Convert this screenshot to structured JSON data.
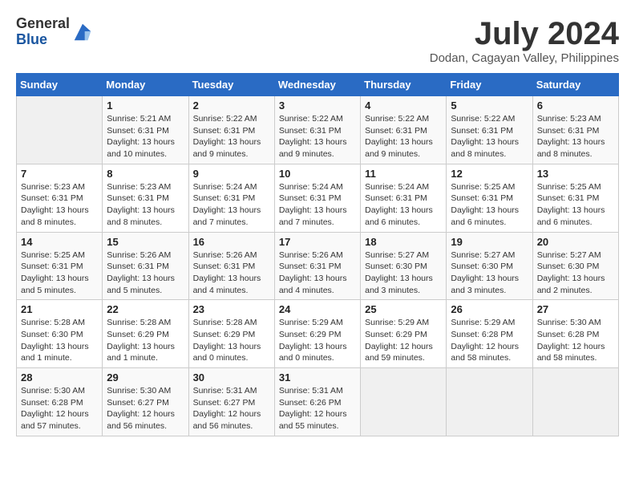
{
  "header": {
    "logo_line1": "General",
    "logo_line2": "Blue",
    "month_title": "July 2024",
    "location": "Dodan, Cagayan Valley, Philippines"
  },
  "weekdays": [
    "Sunday",
    "Monday",
    "Tuesday",
    "Wednesday",
    "Thursday",
    "Friday",
    "Saturday"
  ],
  "weeks": [
    [
      {
        "day": "",
        "info": ""
      },
      {
        "day": "1",
        "info": "Sunrise: 5:21 AM\nSunset: 6:31 PM\nDaylight: 13 hours\nand 10 minutes."
      },
      {
        "day": "2",
        "info": "Sunrise: 5:22 AM\nSunset: 6:31 PM\nDaylight: 13 hours\nand 9 minutes."
      },
      {
        "day": "3",
        "info": "Sunrise: 5:22 AM\nSunset: 6:31 PM\nDaylight: 13 hours\nand 9 minutes."
      },
      {
        "day": "4",
        "info": "Sunrise: 5:22 AM\nSunset: 6:31 PM\nDaylight: 13 hours\nand 9 minutes."
      },
      {
        "day": "5",
        "info": "Sunrise: 5:22 AM\nSunset: 6:31 PM\nDaylight: 13 hours\nand 8 minutes."
      },
      {
        "day": "6",
        "info": "Sunrise: 5:23 AM\nSunset: 6:31 PM\nDaylight: 13 hours\nand 8 minutes."
      }
    ],
    [
      {
        "day": "7",
        "info": "Sunrise: 5:23 AM\nSunset: 6:31 PM\nDaylight: 13 hours\nand 8 minutes."
      },
      {
        "day": "8",
        "info": "Sunrise: 5:23 AM\nSunset: 6:31 PM\nDaylight: 13 hours\nand 8 minutes."
      },
      {
        "day": "9",
        "info": "Sunrise: 5:24 AM\nSunset: 6:31 PM\nDaylight: 13 hours\nand 7 minutes."
      },
      {
        "day": "10",
        "info": "Sunrise: 5:24 AM\nSunset: 6:31 PM\nDaylight: 13 hours\nand 7 minutes."
      },
      {
        "day": "11",
        "info": "Sunrise: 5:24 AM\nSunset: 6:31 PM\nDaylight: 13 hours\nand 6 minutes."
      },
      {
        "day": "12",
        "info": "Sunrise: 5:25 AM\nSunset: 6:31 PM\nDaylight: 13 hours\nand 6 minutes."
      },
      {
        "day": "13",
        "info": "Sunrise: 5:25 AM\nSunset: 6:31 PM\nDaylight: 13 hours\nand 6 minutes."
      }
    ],
    [
      {
        "day": "14",
        "info": "Sunrise: 5:25 AM\nSunset: 6:31 PM\nDaylight: 13 hours\nand 5 minutes."
      },
      {
        "day": "15",
        "info": "Sunrise: 5:26 AM\nSunset: 6:31 PM\nDaylight: 13 hours\nand 5 minutes."
      },
      {
        "day": "16",
        "info": "Sunrise: 5:26 AM\nSunset: 6:31 PM\nDaylight: 13 hours\nand 4 minutes."
      },
      {
        "day": "17",
        "info": "Sunrise: 5:26 AM\nSunset: 6:31 PM\nDaylight: 13 hours\nand 4 minutes."
      },
      {
        "day": "18",
        "info": "Sunrise: 5:27 AM\nSunset: 6:30 PM\nDaylight: 13 hours\nand 3 minutes."
      },
      {
        "day": "19",
        "info": "Sunrise: 5:27 AM\nSunset: 6:30 PM\nDaylight: 13 hours\nand 3 minutes."
      },
      {
        "day": "20",
        "info": "Sunrise: 5:27 AM\nSunset: 6:30 PM\nDaylight: 13 hours\nand 2 minutes."
      }
    ],
    [
      {
        "day": "21",
        "info": "Sunrise: 5:28 AM\nSunset: 6:30 PM\nDaylight: 13 hours\nand 1 minute."
      },
      {
        "day": "22",
        "info": "Sunrise: 5:28 AM\nSunset: 6:29 PM\nDaylight: 13 hours\nand 1 minute."
      },
      {
        "day": "23",
        "info": "Sunrise: 5:28 AM\nSunset: 6:29 PM\nDaylight: 13 hours\nand 0 minutes."
      },
      {
        "day": "24",
        "info": "Sunrise: 5:29 AM\nSunset: 6:29 PM\nDaylight: 13 hours\nand 0 minutes."
      },
      {
        "day": "25",
        "info": "Sunrise: 5:29 AM\nSunset: 6:29 PM\nDaylight: 12 hours\nand 59 minutes."
      },
      {
        "day": "26",
        "info": "Sunrise: 5:29 AM\nSunset: 6:28 PM\nDaylight: 12 hours\nand 58 minutes."
      },
      {
        "day": "27",
        "info": "Sunrise: 5:30 AM\nSunset: 6:28 PM\nDaylight: 12 hours\nand 58 minutes."
      }
    ],
    [
      {
        "day": "28",
        "info": "Sunrise: 5:30 AM\nSunset: 6:28 PM\nDaylight: 12 hours\nand 57 minutes."
      },
      {
        "day": "29",
        "info": "Sunrise: 5:30 AM\nSunset: 6:27 PM\nDaylight: 12 hours\nand 56 minutes."
      },
      {
        "day": "30",
        "info": "Sunrise: 5:31 AM\nSunset: 6:27 PM\nDaylight: 12 hours\nand 56 minutes."
      },
      {
        "day": "31",
        "info": "Sunrise: 5:31 AM\nSunset: 6:26 PM\nDaylight: 12 hours\nand 55 minutes."
      },
      {
        "day": "",
        "info": ""
      },
      {
        "day": "",
        "info": ""
      },
      {
        "day": "",
        "info": ""
      }
    ]
  ]
}
